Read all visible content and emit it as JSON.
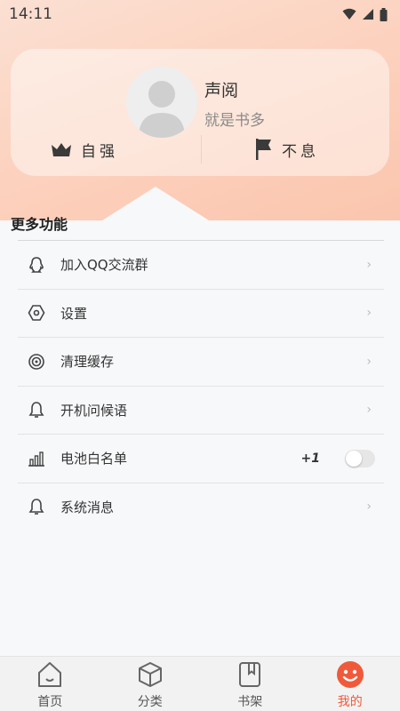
{
  "status_bar": {
    "time": "14:11",
    "icons": [
      "wifi-icon",
      "signal-icon",
      "battery-icon"
    ]
  },
  "profile": {
    "name": "声阅",
    "bio": "就是书多",
    "stat_left": {
      "label": "自强",
      "icon": "crown-icon"
    },
    "stat_right": {
      "label": "不息",
      "icon": "flag-icon"
    }
  },
  "section": {
    "title": "更多功能"
  },
  "menu": [
    {
      "label": "加入QQ交流群",
      "icon": "qq-icon"
    },
    {
      "label": "设置",
      "icon": "settings-hexagon-icon"
    },
    {
      "label": "清理缓存",
      "icon": "clean-cache-icon"
    },
    {
      "label": "开机问候语",
      "icon": "bell-icon"
    },
    {
      "label": "电池白名单",
      "icon": "battery-whitelist-icon",
      "badge": "+1",
      "toggle": false
    },
    {
      "label": "系统消息",
      "icon": "notification-bell-icon"
    }
  ],
  "tabs": [
    {
      "label": "首页",
      "icon": "home-icon",
      "active": false
    },
    {
      "label": "分类",
      "icon": "category-box-icon",
      "active": false
    },
    {
      "label": "书架",
      "icon": "bookshelf-icon",
      "active": false
    },
    {
      "label": "我的",
      "icon": "smiley-profile-icon",
      "active": true
    }
  ],
  "colors": {
    "accent": "#f05a3a",
    "hero_gradient_start": "#fbe0d3",
    "hero_gradient_end": "#fbc5ad"
  }
}
